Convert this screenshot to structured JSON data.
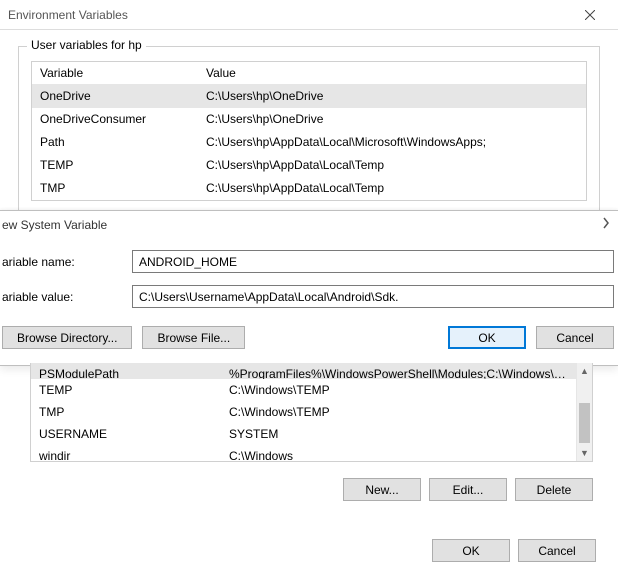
{
  "window": {
    "title": "Environment Variables"
  },
  "userVars": {
    "groupLabel": "User variables for hp",
    "headers": {
      "var": "Variable",
      "val": "Value"
    },
    "rows": [
      {
        "var": "OneDrive",
        "val": "C:\\Users\\hp\\OneDrive",
        "selected": true
      },
      {
        "var": "OneDriveConsumer",
        "val": "C:\\Users\\hp\\OneDrive",
        "selected": false
      },
      {
        "var": "Path",
        "val": "C:\\Users\\hp\\AppData\\Local\\Microsoft\\WindowsApps;",
        "selected": false
      },
      {
        "var": "TEMP",
        "val": "C:\\Users\\hp\\AppData\\Local\\Temp",
        "selected": false
      },
      {
        "var": "TMP",
        "val": "C:\\Users\\hp\\AppData\\Local\\Temp",
        "selected": false
      }
    ]
  },
  "newVarDialog": {
    "title": "ew System Variable",
    "nameLabel": "ariable name:",
    "valueLabel": "ariable value:",
    "nameValue": "ANDROID_HOME",
    "valueValue": "C:\\Users\\Username\\AppData\\Local\\Android\\Sdk.",
    "browseDir": "Browse Directory...",
    "browseFile": "Browse File...",
    "ok": "OK",
    "cancel": "Cancel"
  },
  "sysVars": {
    "rows": [
      {
        "var": "PSModulePath",
        "val": "%ProgramFiles%\\WindowsPowerShell\\Modules;C:\\Windows\\syste..."
      },
      {
        "var": "TEMP",
        "val": "C:\\Windows\\TEMP"
      },
      {
        "var": "TMP",
        "val": "C:\\Windows\\TEMP"
      },
      {
        "var": "USERNAME",
        "val": "SYSTEM"
      },
      {
        "var": "windir",
        "val": "C:\\Windows"
      }
    ],
    "buttons": {
      "new": "New...",
      "edit": "Edit...",
      "del": "Delete"
    }
  },
  "footer": {
    "ok": "OK",
    "cancel": "Cancel"
  }
}
